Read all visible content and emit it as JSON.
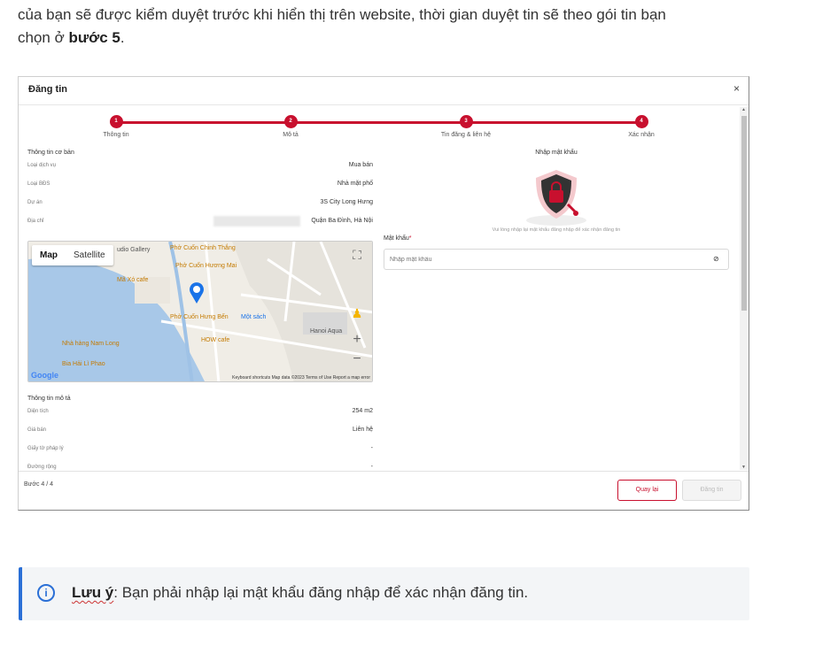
{
  "intro": {
    "line1": "của bạn sẽ được kiểm duyệt trước khi hiển thị trên website, thời gian duyệt tin sẽ theo gói tin bạn",
    "line2_pre": "chọn ở ",
    "line2_bold": "bước 5",
    "line2_post": "."
  },
  "dialog": {
    "title": "Đăng tin",
    "close": "×",
    "steps": [
      {
        "num": "1",
        "label": "Thông tin"
      },
      {
        "num": "2",
        "label": "Mô tả"
      },
      {
        "num": "3",
        "label": "Tin đăng & liên hệ"
      },
      {
        "num": "4",
        "label": "Xác nhận"
      }
    ],
    "basic_title": "Thông tin cơ bản",
    "basic": [
      {
        "key": "Loại dịch vụ",
        "value": "Mua bán"
      },
      {
        "key": "Loại BĐS",
        "value": "Nhà mặt phố"
      },
      {
        "key": "Dự án",
        "value": "3S City Long Hưng"
      },
      {
        "key": "Địa chỉ",
        "value": "Quận Ba Đình, Hà Nội"
      }
    ],
    "map": {
      "tab_map": "Map",
      "tab_satellite": "Satellite",
      "logo": "Google",
      "footer": "Keyboard shortcuts   Map data ©2023   Terms of Use   Report a map error",
      "labels": [
        "Phở Cuốn Chinh Thắng",
        "Phở Cuốn Hương Mai",
        "Mã Xó cafe",
        "Phở Cuốn Hưng Bến",
        "Một sách",
        "HOW cafe",
        "Nhà hàng Nam Long",
        "Bia Hải Lì Phao",
        "Hanoi Aqua",
        "udio Gallery"
      ]
    },
    "desc_title": "Thông tin mô tả",
    "desc": [
      {
        "key": "Diện tích",
        "value": "254 m2"
      },
      {
        "key": "Giá bán",
        "value": "Liên hệ"
      },
      {
        "key": "Giấy tờ pháp lý",
        "value": "-"
      },
      {
        "key": "Đường rộng",
        "value": "-"
      }
    ],
    "password": {
      "heading": "Nhập mật khẩu",
      "hint": "Vui lòng nhập lại mật khẩu đăng nhập để xác nhận đăng tin",
      "label": "Mật khẩu",
      "required": "*",
      "placeholder": "Nhập mật khẩu"
    },
    "footer": {
      "step": "Bước 4 / 4",
      "back": "Quay lại",
      "post": "Đăng tin"
    }
  },
  "note": {
    "icon": "info-icon",
    "bold": "Lưu ý",
    "text": ": Bạn phải nhập lại mật khẩu đăng nhập để xác nhận đăng tin."
  },
  "colors": {
    "accent": "#c8102e",
    "note_border": "#2a6fd6"
  }
}
